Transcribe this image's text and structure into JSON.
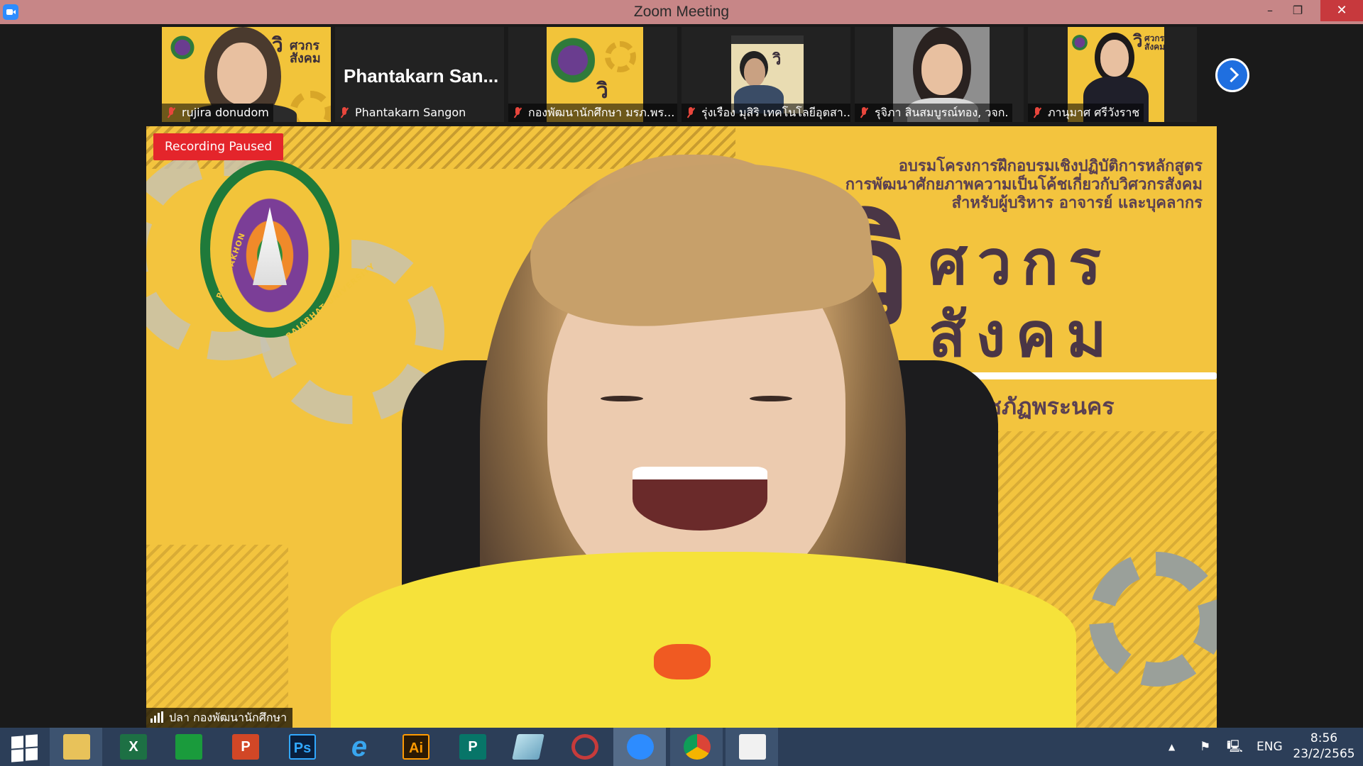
{
  "window": {
    "title": "Zoom Meeting",
    "min": "–",
    "max": "❐",
    "close": "✕"
  },
  "participants": [
    {
      "name": "rujira donudom"
    },
    {
      "name": "Phantakarn Sangon",
      "display": "Phantakarn  San..."
    },
    {
      "name": "กองพัฒนานักศึกษา มรภ.พร..."
    },
    {
      "name": "รุ่งเรือง มุสิริ เทคโนโลยีอุตสา..."
    },
    {
      "name": "รุจิภา สินสมบูรณ์ทอง, วจก."
    },
    {
      "name": "ภานุมาศ ศรีวังราช"
    }
  ],
  "thumb_text": {
    "mini_wi": "วิ",
    "mini_title": "ศวกร\nสังคม"
  },
  "speaker": {
    "name": "ปลา กองพัฒนานักศึกษา",
    "recording_status": "Recording Paused",
    "banner": {
      "line1": "อบรมโครงการฝึกอบรมเชิงปฏิบัติการหลักสูตร",
      "line2": "การพัฒนาศักยภาพความเป็นโค้ชเกี่ยวกับวิศวกรสังคม",
      "line3": "สำหรับผู้บริหาร อาจารย์ และบุคลากร",
      "big_wi": "วิ",
      "big_line1": "ศวกร",
      "big_line2": "สังคม",
      "university": "าวิทยาลัยราชภัฏพระนคร"
    },
    "logo_text_left": "PHRANAKHON",
    "logo_text_right": "RAJABHAT UNIVERSITY"
  },
  "taskbar": {
    "apps": [
      {
        "id": "file-explorer",
        "label": ""
      },
      {
        "id": "excel",
        "label": "X"
      },
      {
        "id": "store",
        "label": ""
      },
      {
        "id": "powerpoint",
        "label": "P"
      },
      {
        "id": "photoshop",
        "label": "Ps"
      },
      {
        "id": "internet-explorer",
        "label": "e"
      },
      {
        "id": "illustrator",
        "label": "Ai"
      },
      {
        "id": "publisher",
        "label": "P"
      },
      {
        "id": "notepad",
        "label": ""
      },
      {
        "id": "hotcape",
        "label": ""
      },
      {
        "id": "zoom",
        "label": ""
      },
      {
        "id": "chrome",
        "label": ""
      },
      {
        "id": "paint",
        "label": ""
      }
    ],
    "language": "ENG",
    "time": "8:56",
    "date": "23/2/2565",
    "tray_arrow": "▲"
  },
  "colors": {
    "titlebar": "#c78687",
    "recording": "#e4252b",
    "taskbar": "#2c3e58",
    "accent": "#1f6fe0"
  }
}
